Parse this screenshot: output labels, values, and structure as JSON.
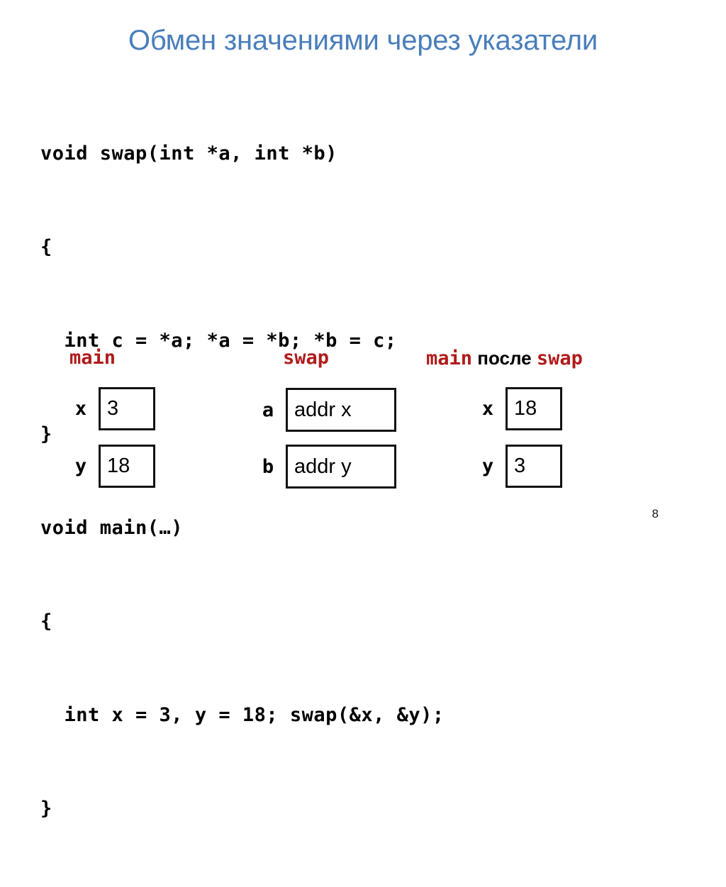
{
  "slide": {
    "title": "Обмен значениями через указатели",
    "title_color": "#4a7ebb",
    "page_number": "8",
    "background": "#ffffff"
  },
  "code": {
    "language": "c",
    "text_color": "#000000",
    "lines": [
      "void swap(int *a, int *b)",
      "{",
      "  int c = *a; *a = *b; *b = c;",
      "}",
      "void main(…)",
      "{",
      "  int x = 3, y = 18; swap(&x, &y);",
      "}"
    ]
  },
  "diagram": {
    "accent_color": "#b01b1b",
    "box_border_color": "#121212",
    "columns": [
      {
        "id": "main-before",
        "header": {
          "code_text": "main",
          "plain_text": "",
          "code_text_2": ""
        },
        "rows": [
          {
            "label": "x",
            "value": "3"
          },
          {
            "label": "y",
            "value": "18"
          }
        ]
      },
      {
        "id": "swap",
        "header": {
          "code_text": "swap",
          "plain_text": "",
          "code_text_2": ""
        },
        "rows": [
          {
            "label": "a",
            "value": "addr x"
          },
          {
            "label": "b",
            "value": "addr y"
          }
        ]
      },
      {
        "id": "main-after",
        "header": {
          "code_text": "main",
          "plain_text": " после ",
          "code_text_2": "swap"
        },
        "rows": [
          {
            "label": "x",
            "value": "18"
          },
          {
            "label": "y",
            "value": "3"
          }
        ]
      }
    ]
  }
}
